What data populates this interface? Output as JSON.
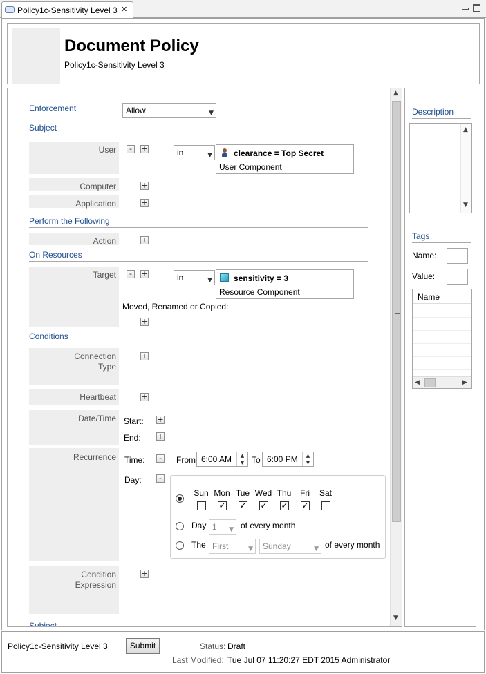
{
  "tab": {
    "title": "Policy1c-Sensitivity Level 3",
    "close": "✕"
  },
  "header": {
    "title": "Document Policy",
    "subtitle": "Policy1c-Sensitivity Level 3"
  },
  "enforcement": {
    "label": "Enforcement",
    "value": "Allow"
  },
  "sections": {
    "subject": "Subject",
    "perform": "Perform the Following",
    "resources": "On Resources",
    "conditions": "Conditions",
    "cut": "Subject"
  },
  "subject": {
    "user_label": "User",
    "user_op": "in",
    "user_component_title": "clearance = Top Secret",
    "user_component_type": "User Component",
    "computer_label": "Computer",
    "application_label": "Application"
  },
  "perform": {
    "action_label": "Action"
  },
  "resources": {
    "target_label": "Target",
    "target_op": "in",
    "resource_title": "sensitivity = 3",
    "resource_type": "Resource Component",
    "moved_label": "Moved, Renamed or Copied:"
  },
  "conditions": {
    "connection_type": "Connection Type",
    "heartbeat": "Heartbeat",
    "datetime": "Date/Time",
    "start": "Start:",
    "end": "End:",
    "recurrence": "Recurrence",
    "time": "Time:",
    "from": "From",
    "from_value": "6:00 AM",
    "to": "To",
    "to_value": "6:00 PM",
    "day": "Day:",
    "days": [
      {
        "name": "Sun",
        "checked": false
      },
      {
        "name": "Mon",
        "checked": true
      },
      {
        "name": "Tue",
        "checked": true
      },
      {
        "name": "Wed",
        "checked": true
      },
      {
        "name": "Thu",
        "checked": true
      },
      {
        "name": "Fri",
        "checked": true
      },
      {
        "name": "Sat",
        "checked": false
      }
    ],
    "day_option_label": "Day",
    "day_option_value": "1",
    "of_every_month": "of every month",
    "the_label": "The",
    "the_ordinal": "First",
    "the_weekday": "Sunday",
    "of_every_month_2": "of every month",
    "condition_expression": "Condition Expression"
  },
  "side": {
    "description_label": "Description",
    "tags_label": "Tags",
    "name_label": "Name:",
    "value_label": "Value:",
    "table_header": "Name"
  },
  "footer": {
    "policy_name": "Policy1c-Sensitivity Level 3",
    "submit": "Submit",
    "status_label": "Status:",
    "status_value": "Draft",
    "modified_label": "Last Modified:",
    "modified_value": "Tue Jul 07 11:20:27 EDT 2015 Administrator"
  }
}
